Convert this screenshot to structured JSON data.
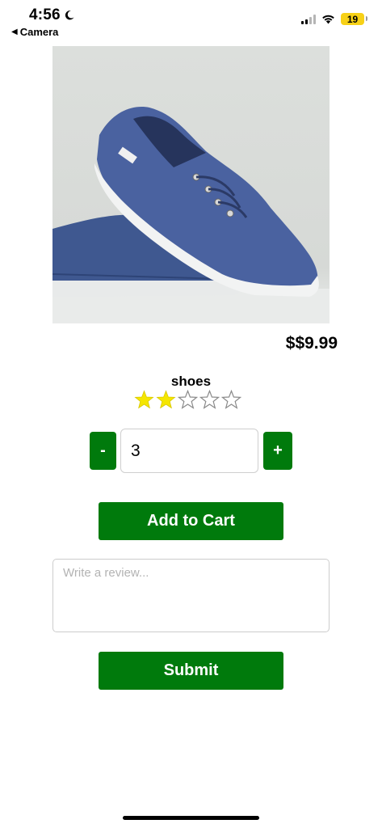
{
  "status_bar": {
    "time": "4:56",
    "back_label": "Camera",
    "battery_level": "19",
    "icons": [
      "moon-icon",
      "signal-icon",
      "wifi-icon",
      "battery-icon"
    ]
  },
  "product": {
    "image": "blue-canvas-sneakers-photo",
    "price": "$$9.99",
    "name": "shoes",
    "rating": 2,
    "rating_max": 5
  },
  "quantity": {
    "minus_label": "-",
    "value": "3",
    "plus_label": "+"
  },
  "actions": {
    "add_to_cart_label": "Add to Cart",
    "submit_label": "Submit"
  },
  "review": {
    "placeholder": "Write a review..."
  },
  "colors": {
    "button_green": "#007a0c",
    "star_filled": "#f5e600",
    "star_empty_outline": "#8a8a8a",
    "battery": "#f7d117"
  }
}
